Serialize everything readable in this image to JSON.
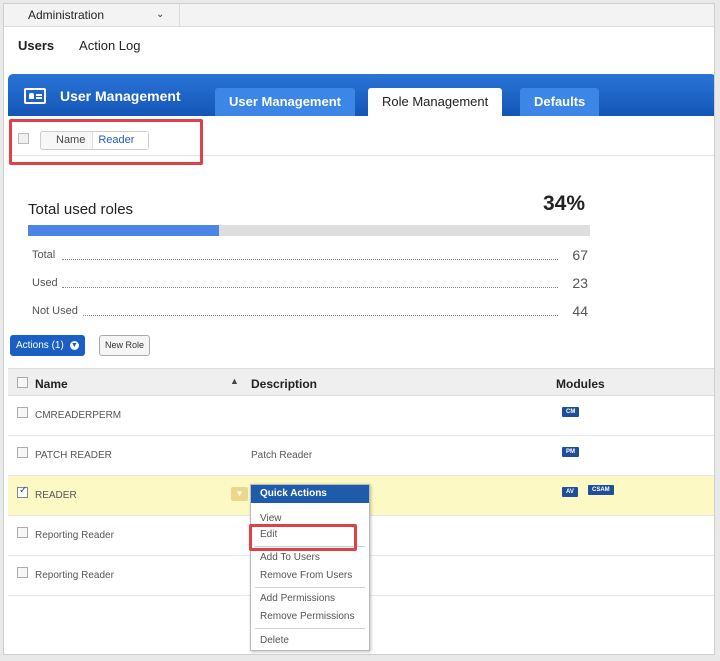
{
  "admin_bar": {
    "selected": "Administration"
  },
  "nav": {
    "items": [
      "Users",
      "Action Log"
    ],
    "active": "Users"
  },
  "header": {
    "title": "User Management",
    "tabs": [
      "User Management",
      "Role Management",
      "Defaults"
    ],
    "selected_tab": "Role Management"
  },
  "filter": {
    "key": "Name",
    "value": "Reader"
  },
  "stats": {
    "title": "Total used roles",
    "percent_label": "34%",
    "progress_fraction": 0.34,
    "rows": [
      {
        "label": "Total",
        "value": "67"
      },
      {
        "label": "Used",
        "value": "23"
      },
      {
        "label": "Not Used",
        "value": "44"
      }
    ]
  },
  "toolbar": {
    "actions_label": "Actions (1)",
    "new_role_label": "New Role"
  },
  "table": {
    "headers": {
      "name": "Name",
      "description": "Description",
      "modules": "Modules"
    },
    "rows": [
      {
        "name": "CMREADERPERM",
        "description": "",
        "modules": [
          "CM"
        ],
        "checked": false
      },
      {
        "name": "PATCH READER",
        "description": "Patch Reader",
        "modules": [
          "PM"
        ],
        "checked": false
      },
      {
        "name": "READER",
        "description": "",
        "modules": [
          "AV",
          "CSAM"
        ],
        "checked": true
      },
      {
        "name": "Reporting Reader",
        "description": "",
        "modules": [],
        "checked": false
      },
      {
        "name": "Reporting Reader",
        "description": "",
        "modules": [],
        "checked": false
      }
    ]
  },
  "quick_actions": {
    "title": "Quick Actions",
    "items": [
      "View",
      "Edit",
      "Add To Users",
      "Remove From Users",
      "Add Permissions",
      "Remove Permissions",
      "Delete"
    ]
  },
  "colors": {
    "header_blue": "#1456b8",
    "tab_blue": "#3b86e6",
    "highlight_row": "#fdf9c4",
    "annotation_red": "#e0404a",
    "badge_navy": "#1f4f98"
  }
}
